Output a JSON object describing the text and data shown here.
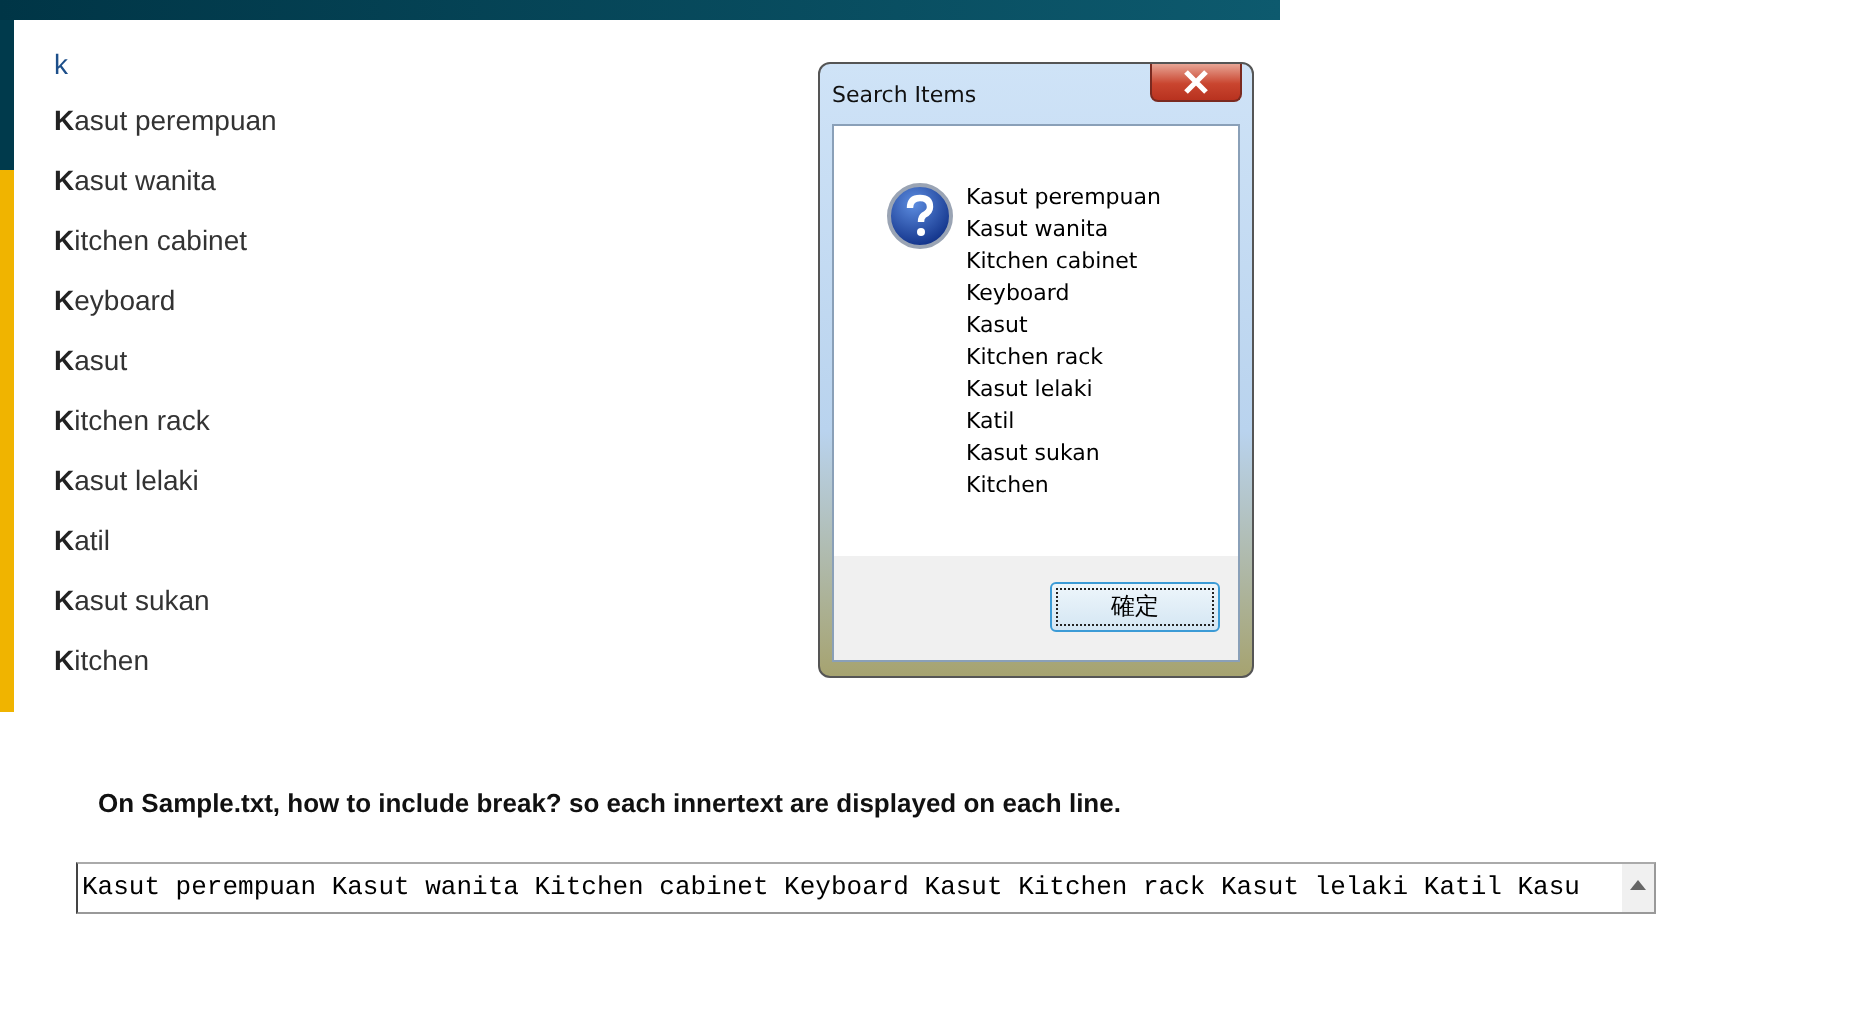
{
  "search": {
    "value": "k"
  },
  "suggestions": [
    "**K**asut perempuan",
    "**K**asut wanita",
    "**K**itchen cabinet",
    "**K**eyboard",
    "**K**asut",
    "**K**itchen rack",
    "**K**asut lelaki",
    "**K**atil",
    "**K**asut sukan",
    "**K**itchen"
  ],
  "dialog": {
    "title": "Search Items",
    "message_lines": [
      "Kasut perempuan",
      "Kasut wanita",
      "Kitchen cabinet",
      "Keyboard",
      "Kasut",
      "Kitchen rack",
      "Kasut lelaki",
      "Katil",
      "Kasut sukan",
      "Kitchen"
    ],
    "buttons": [
      "確定"
    ]
  },
  "question": "On Sample.txt, how to include break? so each innertext are displayed on each line.",
  "textarea": {
    "value": "Kasut perempuan Kasut wanita Kitchen cabinet Keyboard Kasut Kitchen rack Kasut lelaki Katil Kasu"
  }
}
